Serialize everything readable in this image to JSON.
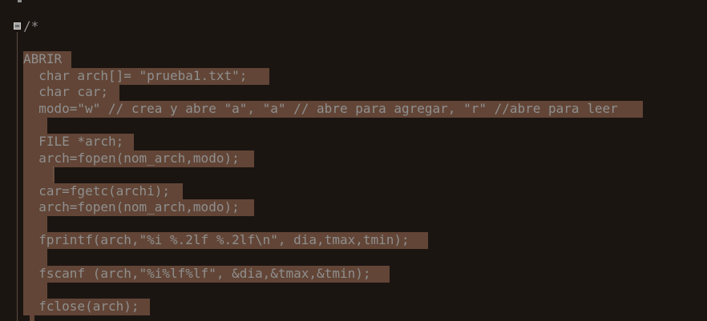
{
  "colors": {
    "background": "#1b1512",
    "selection": "#624536",
    "text": "#8f8f8f"
  },
  "icons": {
    "fold": "fold-collapse-icon"
  },
  "code": {
    "comment_open": "/*",
    "lines": [
      "ABRIR ",
      "  char arch[]= \"prueba1.txt\";  ",
      "  char car;",
      "  modo=\"w\" // crea y abre \"a\", \"a\" // abre para agregar, \"r\" //abre para leer ",
      "  ",
      "  FILE *arch;",
      "  arch=fopen(nom_arch,modo);  ",
      "  ",
      "  car=fgetc(archi); ",
      "  arch=fopen(nom_arch,modo);  ",
      "  ",
      "  fprintf(arch,\"%i %.2lf %.2lf\\n\", dia,tmax,tmin); ",
      "  ",
      "  fscanf (arch,\"%i%lf%lf\", &dia,&tmax,&tmin); ",
      "  ",
      "  fclose(arch); "
    ]
  }
}
